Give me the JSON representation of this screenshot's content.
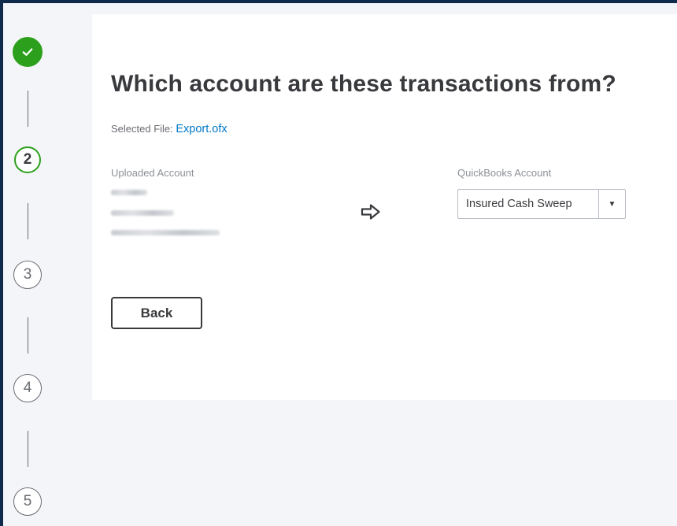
{
  "stepper": {
    "steps": [
      {
        "label": "",
        "state": "done"
      },
      {
        "label": "2",
        "state": "current"
      },
      {
        "label": "3",
        "state": "todo"
      },
      {
        "label": "4",
        "state": "todo"
      },
      {
        "label": "5",
        "state": "todo"
      }
    ]
  },
  "main": {
    "title": "Which account are these transactions from?",
    "selected_file_label": "Selected File: ",
    "selected_file_name": "Export.ofx",
    "uploaded_account_label": "Uploaded Account",
    "quickbooks_account_label": "QuickBooks Account",
    "quickbooks_account_value": "Insured Cash Sweep",
    "back_label": "Back"
  },
  "colors": {
    "accent_green": "#2ca01c",
    "link_blue": "#0077c5",
    "text_dark": "#393a3d",
    "frame_navy": "#0f2a4a"
  },
  "icons": {
    "step_done": "checkmark-icon",
    "mapping_arrow": "arrow-right-outline-icon",
    "select_caret": "caret-down-icon"
  }
}
